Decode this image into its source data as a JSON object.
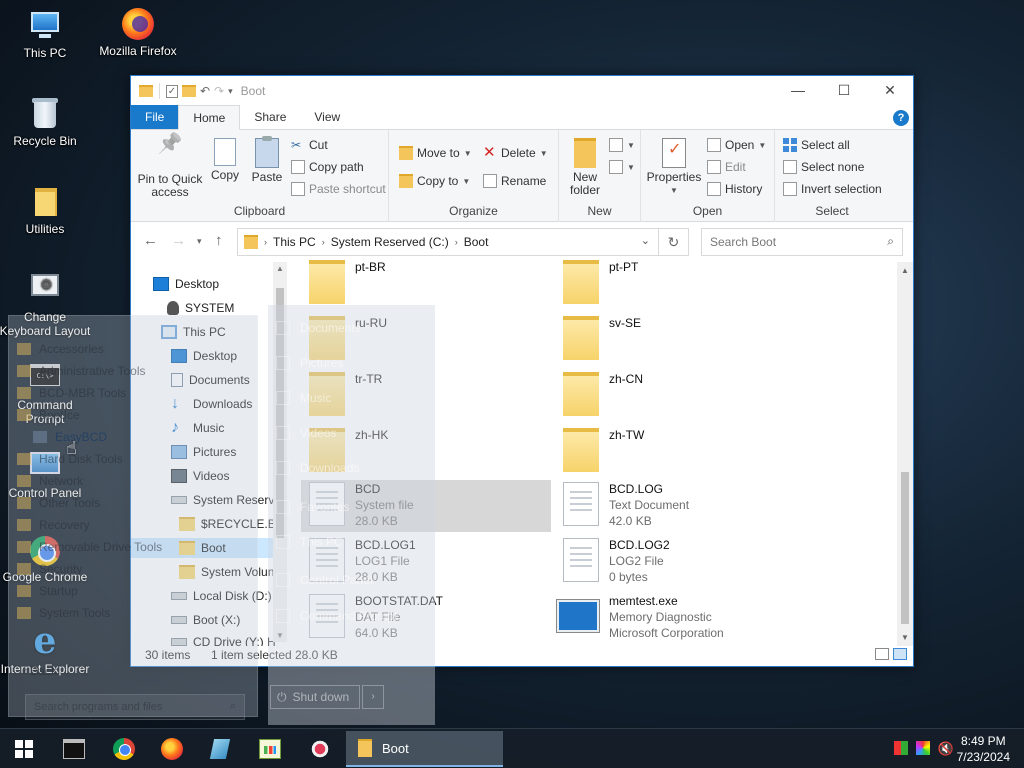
{
  "desktop": {
    "icons": [
      {
        "label": "This PC"
      },
      {
        "label": "Mozilla Firefox"
      },
      {
        "label": "Recycle Bin"
      },
      {
        "label": "Utilities"
      },
      {
        "label": "Change Keyboard Layout"
      },
      {
        "label": "Command Prompt"
      },
      {
        "label": "Control Panel"
      },
      {
        "label": "Google Chrome"
      },
      {
        "label": "Internet Explorer"
      }
    ]
  },
  "explorer": {
    "title": "Boot",
    "tabs": {
      "file": "File",
      "home": "Home",
      "share": "Share",
      "view": "View"
    },
    "clipboard": {
      "pin": "Pin to Quick access",
      "copy": "Copy",
      "paste": "Paste",
      "cut": "Cut",
      "copy_path": "Copy path",
      "paste_shortcut": "Paste shortcut",
      "group": "Clipboard"
    },
    "organize": {
      "move_to": "Move to",
      "copy_to": "Copy to",
      "delete": "Delete",
      "rename": "Rename",
      "group": "Organize"
    },
    "new": {
      "new_folder": "New folder",
      "group": "New"
    },
    "open": {
      "properties": "Properties",
      "open": "Open",
      "edit": "Edit",
      "history": "History",
      "group": "Open"
    },
    "select": {
      "select_all": "Select all",
      "select_none": "Select none",
      "invert": "Invert selection",
      "group": "Select"
    },
    "address": {
      "seg1": "This PC",
      "seg2": "System Reserved (C:)",
      "seg3": "Boot"
    },
    "search_placeholder": "Search Boot",
    "nav": [
      {
        "label": "Desktop"
      },
      {
        "label": "SYSTEM"
      },
      {
        "label": "This PC"
      },
      {
        "label": "Desktop"
      },
      {
        "label": "Documents"
      },
      {
        "label": "Downloads"
      },
      {
        "label": "Music"
      },
      {
        "label": "Pictures"
      },
      {
        "label": "Videos"
      },
      {
        "label": "System Reserve"
      },
      {
        "label": "$RECYCLE.BIN"
      },
      {
        "label": "Boot"
      },
      {
        "label": "System Volun"
      },
      {
        "label": "Local Disk (D:)"
      },
      {
        "label": "Boot (X:)"
      },
      {
        "label": "CD Drive (Y:) H"
      }
    ],
    "files": [
      {
        "name": "pt-BR",
        "line2": "",
        "line3": ""
      },
      {
        "name": "pt-PT",
        "line2": "",
        "line3": ""
      },
      {
        "name": "ru-RU",
        "line2": "",
        "line3": ""
      },
      {
        "name": "sv-SE",
        "line2": "",
        "line3": ""
      },
      {
        "name": "tr-TR",
        "line2": "",
        "line3": ""
      },
      {
        "name": "zh-CN",
        "line2": "",
        "line3": ""
      },
      {
        "name": "zh-HK",
        "line2": "",
        "line3": ""
      },
      {
        "name": "zh-TW",
        "line2": "",
        "line3": ""
      },
      {
        "name": "BCD",
        "line2": "System file",
        "line3": "28.0 KB"
      },
      {
        "name": "BCD.LOG",
        "line2": "Text Document",
        "line3": "42.0 KB"
      },
      {
        "name": "BCD.LOG1",
        "line2": "LOG1 File",
        "line3": "28.0 KB"
      },
      {
        "name": "BCD.LOG2",
        "line2": "LOG2 File",
        "line3": "0 bytes"
      },
      {
        "name": "BOOTSTAT.DAT",
        "line2": "DAT File",
        "line3": "64.0 KB"
      },
      {
        "name": "memtest.exe",
        "line2": "Memory Diagnostic",
        "line3": "Microsoft Corporation"
      }
    ],
    "status": {
      "count": "30 items",
      "selected": "1 item selected",
      "size": "28.0 KB"
    }
  },
  "startmenu": {
    "left_items": [
      {
        "label": "Accessories"
      },
      {
        "label": "Administrative Tools"
      },
      {
        "label": "BCD-MBR Tools"
      },
      {
        "label": "BootIce"
      },
      {
        "label": "EasyBCD"
      },
      {
        "label": "Hard Disk Tools"
      },
      {
        "label": "Network"
      },
      {
        "label": "Other Tools"
      },
      {
        "label": "Recovery"
      },
      {
        "label": "Removable Drive Tools"
      },
      {
        "label": "Security"
      },
      {
        "label": "Startup"
      },
      {
        "label": "System Tools"
      }
    ],
    "back": "Back",
    "search_placeholder": "Search programs and files",
    "right_items": [
      {
        "label": "Documents"
      },
      {
        "label": "Pictures"
      },
      {
        "label": "Music"
      },
      {
        "label": "Videos"
      },
      {
        "label": "Downloads"
      },
      {
        "label": "Favorites"
      },
      {
        "label": "This PC"
      },
      {
        "label": "Control Panel"
      },
      {
        "label": "Command Prompt"
      }
    ],
    "shutdown": "Shut down"
  },
  "taskbar": {
    "active_task": "Boot",
    "time": "8:49 PM",
    "date": "7/23/2024"
  }
}
